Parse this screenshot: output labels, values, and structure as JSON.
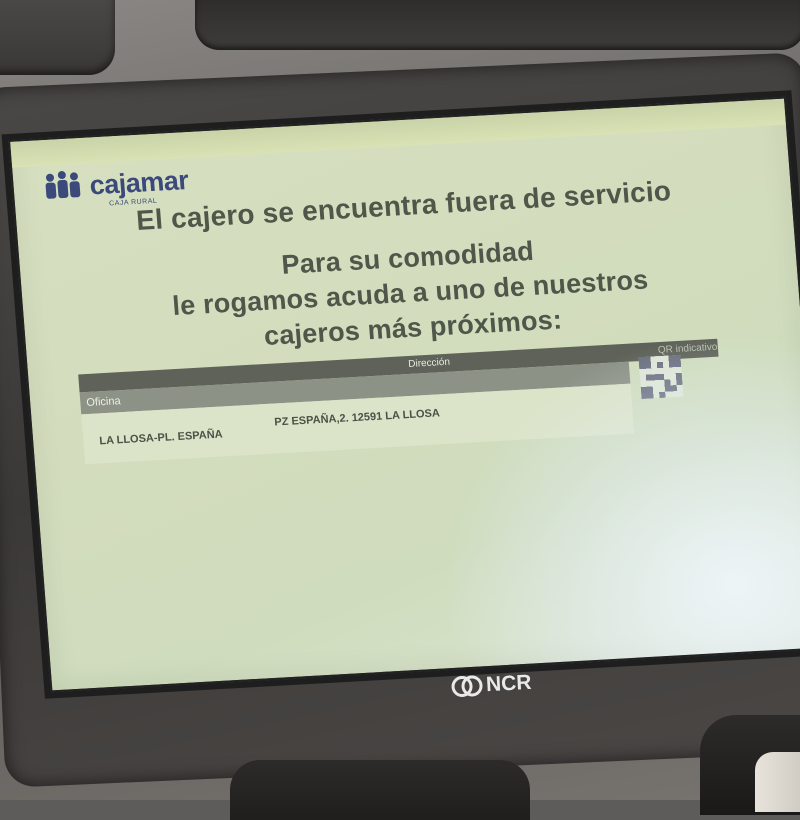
{
  "screen": {
    "brand": {
      "name": "cajamar",
      "subtitle": "CAJA RURAL",
      "color": "#3b4a7a"
    },
    "message": {
      "title": "El cajero se encuentra fuera de servicio",
      "line1": "Para su comodidad",
      "line2": "le rogamos acuda a uno de nuestros",
      "line3": "cajeros más próximos:"
    },
    "table": {
      "section_label": "Oficina",
      "columns": [
        "Dirección",
        "QR indicativo"
      ],
      "rows": [
        {
          "office": "LA LLOSA-PL. ESPAÑA",
          "address": "PZ ESPAÑA,2. 12591 LA LLOSA"
        }
      ]
    },
    "background_color": "#d3ddbd",
    "text_color": "#4f564a"
  },
  "hardware": {
    "manufacturer_logo": "NCR",
    "manufacturer_icon": "ncr-logo-icon"
  }
}
